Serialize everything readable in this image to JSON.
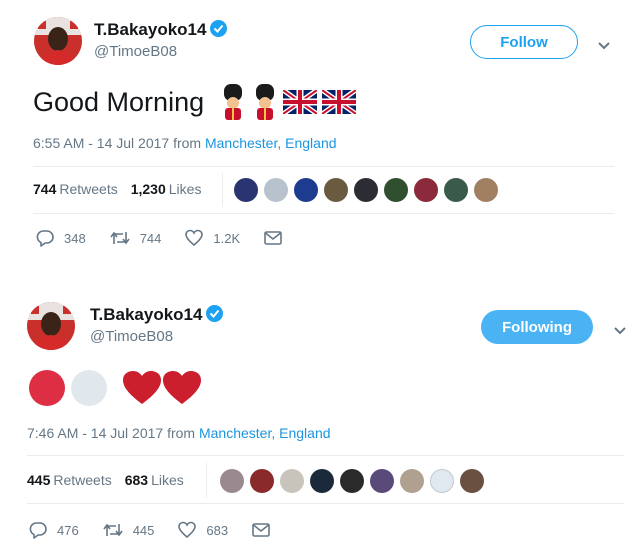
{
  "tweets": [
    {
      "display_name": "T.Bakayoko14",
      "handle": "@TimoeB08",
      "follow_label": "Follow",
      "text": "Good Morning",
      "time": "6:55 AM - 14 Jul 2017 from",
      "location": "Manchester, England",
      "retweets_count": "744",
      "retweets_label": "Retweets",
      "likes_count": "1,230",
      "likes_label": "Likes",
      "reply_count": "348",
      "retweet_action_count": "744",
      "like_action_count": "1.2K"
    },
    {
      "display_name": "T.Bakayoko14",
      "handle": "@TimoeB08",
      "follow_label": "Following",
      "time": "7:46 AM - 14 Jul 2017 from",
      "location": "Manchester, England",
      "retweets_count": "445",
      "retweets_label": "Retweets",
      "likes_count": "683",
      "likes_label": "Likes",
      "reply_count": "476",
      "retweet_action_count": "445",
      "like_action_count": "683"
    }
  ],
  "icons": [
    "verified-icon",
    "chevron-down-icon",
    "reply-icon",
    "retweet-icon",
    "like-icon",
    "message-icon",
    "guardsman-emoji",
    "uk-flag-emoji",
    "red-circle-emoji",
    "white-circle-emoji",
    "red-heart-emoji"
  ],
  "colors": {
    "accent": "#1da1f2",
    "link": "#1b95e0",
    "muted": "#657786",
    "following_bg": "#4ab3f4",
    "heart": "#dd2e44"
  }
}
